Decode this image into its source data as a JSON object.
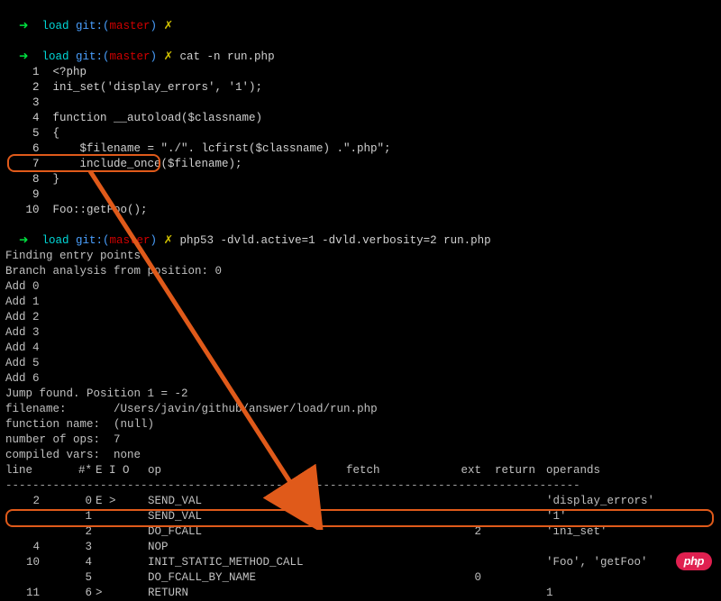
{
  "prompt1": {
    "arrow": "➜ ",
    "user": " load ",
    "git": "git:(",
    "branch": "master",
    "gitclose": ") ",
    "dirty": "✗"
  },
  "prompt2": {
    "arrow": "➜ ",
    "user": " load ",
    "git": "git:(",
    "branch": "master",
    "gitclose": ") ",
    "dirty": "✗ ",
    "cmd": "cat -n run.php"
  },
  "code": [
    {
      "n": "1",
      "t": "<?php"
    },
    {
      "n": "2",
      "t": "ini_set('display_errors', '1');"
    },
    {
      "n": "3",
      "t": ""
    },
    {
      "n": "4",
      "t": "function __autoload($classname)"
    },
    {
      "n": "5",
      "t": "{"
    },
    {
      "n": "6",
      "t": "    $filename = \"./\". lcfirst($classname) .\".php\";"
    },
    {
      "n": "7",
      "t": "    include_once($filename);"
    },
    {
      "n": "8",
      "t": "}"
    },
    {
      "n": "9",
      "t": ""
    },
    {
      "n": "10",
      "t": "Foo::getFoo();"
    }
  ],
  "prompt3": {
    "arrow": "➜ ",
    "user": " load ",
    "git": "git:(",
    "branch": "master",
    "gitclose": ") ",
    "dirty": "✗ ",
    "cmd": "php53 -dvld.active=1 -dvld.verbosity=2 run.php"
  },
  "out": [
    "Finding entry points",
    "Branch analysis from position: 0",
    "Add 0",
    "Add 1",
    "Add 2",
    "Add 3",
    "Add 4",
    "Add 5",
    "Add 6",
    "Jump found. Position 1 = -2",
    "filename:       /Users/javin/github/answer/load/run.php",
    "function name:  (null)",
    "number of ops:  7",
    "compiled vars:  none"
  ],
  "hdr": {
    "line": "line",
    "num": "#*",
    "eio": "E I O",
    "op": "op",
    "fetch": "fetch",
    "ext": "ext",
    "return": "return",
    "operands": "operands"
  },
  "sep": "-------------------------------------------------------------------------------------",
  "ops": [
    {
      "line": "2",
      "num": "0",
      "eio": "E >",
      "op": "SEND_VAL",
      "fetch": "",
      "ext": "",
      "ret": "",
      "oper": "'display_errors'"
    },
    {
      "line": "",
      "num": "1",
      "eio": "",
      "op": "SEND_VAL",
      "fetch": "",
      "ext": "",
      "ret": "",
      "oper": "'1'"
    },
    {
      "line": "",
      "num": "2",
      "eio": "",
      "op": "DO_FCALL",
      "fetch": "",
      "ext": "2",
      "ret": "",
      "oper": "'ini_set'"
    },
    {
      "line": "4",
      "num": "3",
      "eio": "",
      "op": "NOP",
      "fetch": "",
      "ext": "",
      "ret": "",
      "oper": ""
    },
    {
      "line": "10",
      "num": "4",
      "eio": "",
      "op": "INIT_STATIC_METHOD_CALL",
      "fetch": "",
      "ext": "",
      "ret": "",
      "oper": "'Foo', 'getFoo'"
    },
    {
      "line": "",
      "num": "5",
      "eio": "",
      "op": "DO_FCALL_BY_NAME",
      "fetch": "",
      "ext": "0",
      "ret": "",
      "oper": ""
    },
    {
      "line": "11",
      "num": "6",
      "eio": ">",
      "op": "RETURN",
      "fetch": "",
      "ext": "",
      "ret": "",
      "oper": "1"
    }
  ],
  "badge": "php"
}
